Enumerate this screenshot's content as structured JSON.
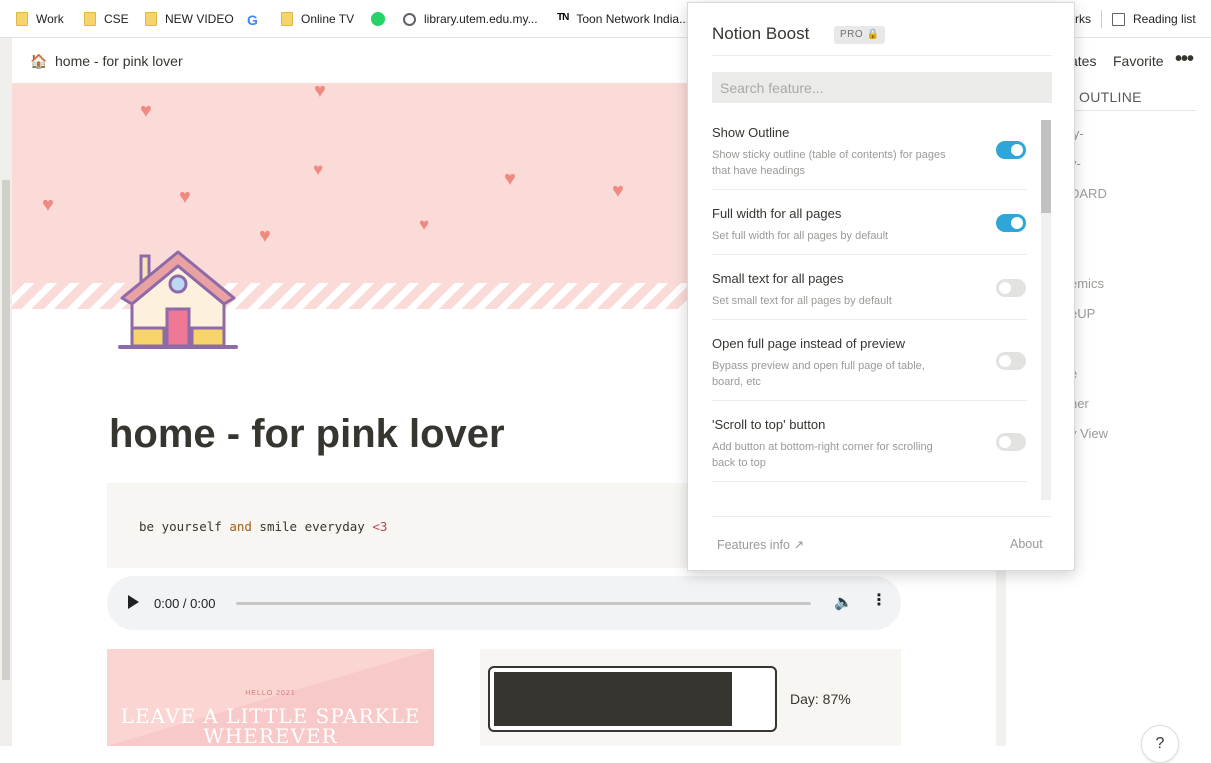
{
  "bookmarks": [
    {
      "label": "Work",
      "icon": "folder-icon"
    },
    {
      "label": "CSE",
      "icon": "folder-icon"
    },
    {
      "label": "NEW VIDEO",
      "icon": "folder-icon"
    },
    {
      "label": "",
      "icon": "google-icon",
      "glyph": "G"
    },
    {
      "label": "Online TV",
      "icon": "folder-icon"
    },
    {
      "label": "",
      "icon": "whatsapp-icon"
    },
    {
      "label": "library.utem.edu.my...",
      "icon": "globe-icon"
    },
    {
      "label": "Toon Network India...",
      "icon": "tn-icon",
      "glyph": "TN"
    },
    {
      "label": "rks",
      "icon": "none"
    },
    {
      "label": "Reading list",
      "icon": "reading-list-icon"
    }
  ],
  "topbar": {
    "breadcrumb": "home - for pink lover",
    "templates_label": "ates",
    "favorite_label": "Favorite",
    "more_label": "•••"
  },
  "page": {
    "title": "home - for pink lover",
    "code": {
      "before": "be yourself ",
      "kw": "and",
      "middle": " smile everyday ",
      "tail": "<3"
    },
    "audio": {
      "time": "0:00 / 0:00"
    },
    "card": {
      "small": "HELLO 2021",
      "big": "LEAVE A LITTLE SPARKLE WHEREVER"
    },
    "progress": {
      "label": "Day: 87%",
      "value": 0.87
    }
  },
  "sidebar": {
    "outline_title": "OUTLINE",
    "items": [
      "ly-",
      "y-",
      "DARD",
      "emics",
      "eUP",
      "e",
      "ner",
      "y View"
    ],
    "help": "?"
  },
  "popup": {
    "title": "Notion Boost",
    "badge": "PRO",
    "search_placeholder": "Search feature...",
    "features": [
      {
        "name": "Show Outline",
        "desc": "Show sticky outline (table of contents) for pages that have headings",
        "on": true
      },
      {
        "name": "Full width for all pages",
        "desc": "Set full width for all pages by default",
        "on": true
      },
      {
        "name": "Small text for all pages",
        "desc": "Set small text for all pages by default",
        "on": false
      },
      {
        "name": "Open full page instead of preview",
        "desc": "Bypass preview and open full page of table, board, etc",
        "on": false
      },
      {
        "name": "'Scroll to top' button",
        "desc": "Add button at bottom-right corner for scrolling back to top",
        "on": false
      }
    ],
    "features_info": "Features info",
    "about": "About"
  },
  "colors": {
    "accent": "#2ea6d8",
    "cover": "#fadbd8",
    "heart": "#f08a80"
  }
}
